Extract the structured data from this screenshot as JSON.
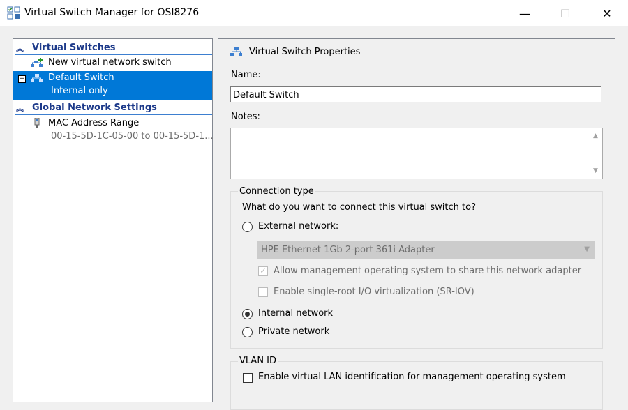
{
  "window": {
    "title": "Virtual Switch Manager for OSI8276",
    "minimize_glyph": "—",
    "maximize_glyph": "☐",
    "close_glyph": "✕"
  },
  "sidebar": {
    "virtual_switches": {
      "header": "Virtual Switches",
      "items": [
        {
          "label": "New virtual network switch",
          "icon": "new-switch-icon"
        },
        {
          "label": "Default Switch",
          "sublabel": "Internal only",
          "icon": "network-switch-icon",
          "selected": true
        }
      ]
    },
    "global_settings": {
      "header": "Global Network Settings",
      "items": [
        {
          "label": "MAC Address Range",
          "sublabel": "00-15-5D-1C-05-00 to 00-15-5D-1...",
          "icon": "mac-address-icon"
        }
      ]
    }
  },
  "properties": {
    "header": "Virtual Switch Properties",
    "name_label": "Name:",
    "name_value": "Default Switch",
    "notes_label": "Notes:",
    "notes_value": "",
    "connection": {
      "group_label": "Connection type",
      "question": "What do you want to connect this virtual switch to?",
      "external_label": "External network:",
      "adapter_value": "HPE Ethernet 1Gb 2-port 361i Adapter",
      "allow_mgmt_label": "Allow management operating system to share this network adapter",
      "allow_mgmt_checked": true,
      "sriov_label": "Enable single-root I/O virtualization (SR-IOV)",
      "sriov_checked": false,
      "internal_label": "Internal network",
      "private_label": "Private network",
      "selected": "internal"
    },
    "vlan": {
      "group_label": "VLAN ID",
      "enable_label": "Enable virtual LAN identification for management operating system",
      "enabled": false
    }
  },
  "colors": {
    "selection": "#0078d7",
    "section_header": "#1d3a8a"
  }
}
